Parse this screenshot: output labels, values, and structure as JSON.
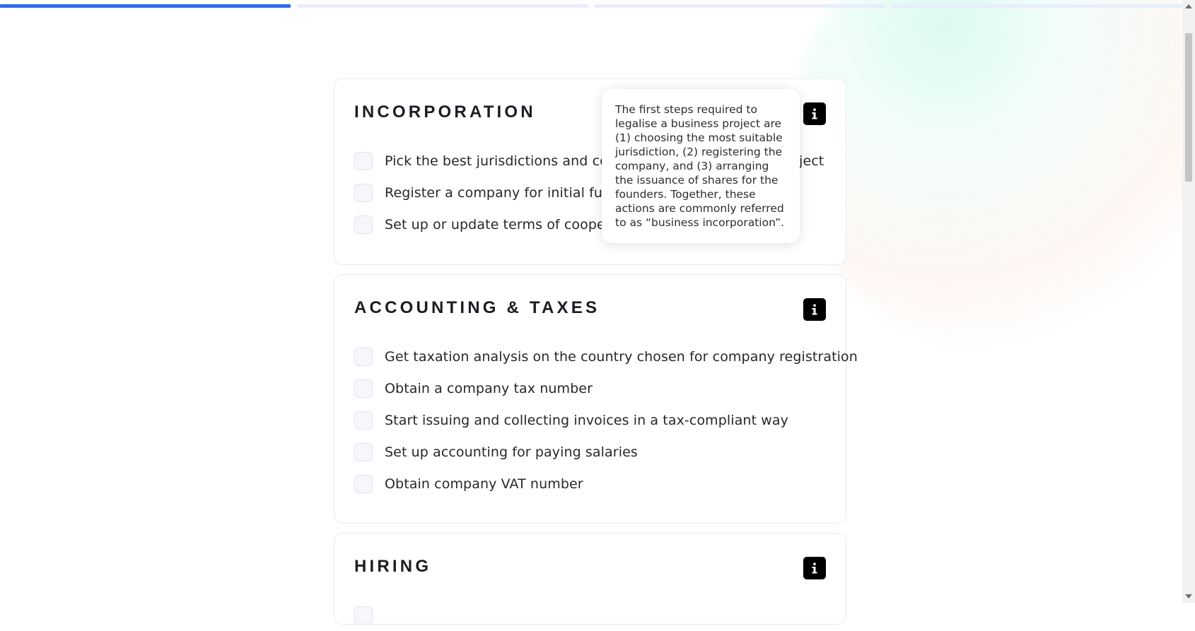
{
  "progress": {
    "steps": 4,
    "current_step": 1
  },
  "sections": [
    {
      "title": "INCORPORATION",
      "info_icon": "info-icon",
      "items": [
        {
          "label": "Pick the best jurisdictions and corporate structure for my project",
          "checked": false
        },
        {
          "label": "Register a company for initial fundraising",
          "checked": false
        },
        {
          "label": "Set up or update terms of cooperation with co-founders",
          "checked": false
        }
      ]
    },
    {
      "title": "ACCOUNTING & TAXES",
      "info_icon": "info-icon",
      "items": [
        {
          "label": "Get taxation analysis on the country chosen for company registration",
          "checked": false
        },
        {
          "label": "Obtain a company tax number",
          "checked": false
        },
        {
          "label": "Start issuing and collecting invoices in a tax-compliant way",
          "checked": false
        },
        {
          "label": "Set up accounting for paying salaries",
          "checked": false
        },
        {
          "label": "Obtain company VAT number",
          "checked": false
        }
      ]
    },
    {
      "title": "HIRING",
      "info_icon": "info-icon",
      "items": []
    }
  ],
  "tooltip": {
    "text": "The first steps required to legalise a business project are (1) choosing the most suitable jurisdiction, (2) registering the company, and (3) arranging the issuance of shares for the founders. Together, these actions are commonly referred to as “business incorporation”."
  },
  "colors": {
    "accent": "#2f6bf0",
    "progress_inactive": "#e8eefb",
    "info_button": "#000000"
  }
}
